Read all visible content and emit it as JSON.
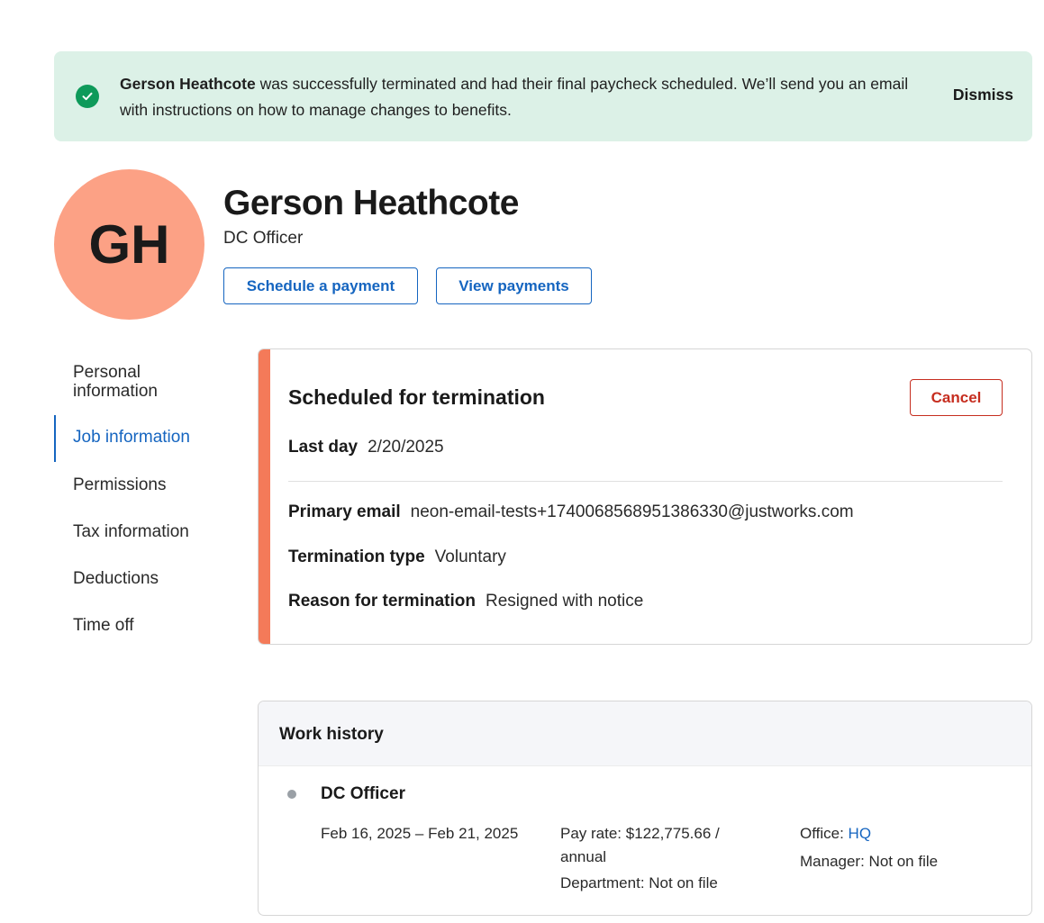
{
  "banner": {
    "name": "Gerson Heathcote",
    "message": " was successfully terminated and had their final paycheck scheduled. We’ll send you an email with instructions on how to manage changes to benefits.",
    "dismiss_label": "Dismiss",
    "status_color": "#0e9a5a"
  },
  "profile": {
    "initials": "GH",
    "name": "Gerson Heathcote",
    "role": "DC Officer",
    "avatar_color": "#fca185",
    "schedule_payment_label": "Schedule a payment",
    "view_payments_label": "View payments"
  },
  "sidebar": {
    "items": [
      {
        "label": "Personal information",
        "active": false
      },
      {
        "label": "Job information",
        "active": true
      },
      {
        "label": "Permissions",
        "active": false
      },
      {
        "label": "Tax information",
        "active": false
      },
      {
        "label": "Deductions",
        "active": false
      },
      {
        "label": "Time off",
        "active": false
      }
    ]
  },
  "termination": {
    "title": "Scheduled for termination",
    "cancel_label": "Cancel",
    "last_day_label": "Last day",
    "last_day_value": "2/20/2025",
    "email_label": "Primary email",
    "email_value": "neon-email-tests+1740068568951386330@justworks.com",
    "type_label": "Termination type",
    "type_value": "Voluntary",
    "reason_label": "Reason for termination",
    "reason_value": "Resigned with notice",
    "accent_color": "#f47a59"
  },
  "work_history": {
    "title": "Work history",
    "job_title": "DC Officer",
    "dates": "Feb 16, 2025 – Feb 21, 2025",
    "pay_rate_line1": "Pay rate: $122,775.66 /",
    "pay_rate_line2": "annual",
    "department": "Department: Not on file",
    "office_label": "Office: ",
    "office_value": "HQ",
    "manager": "Manager: Not on file"
  }
}
